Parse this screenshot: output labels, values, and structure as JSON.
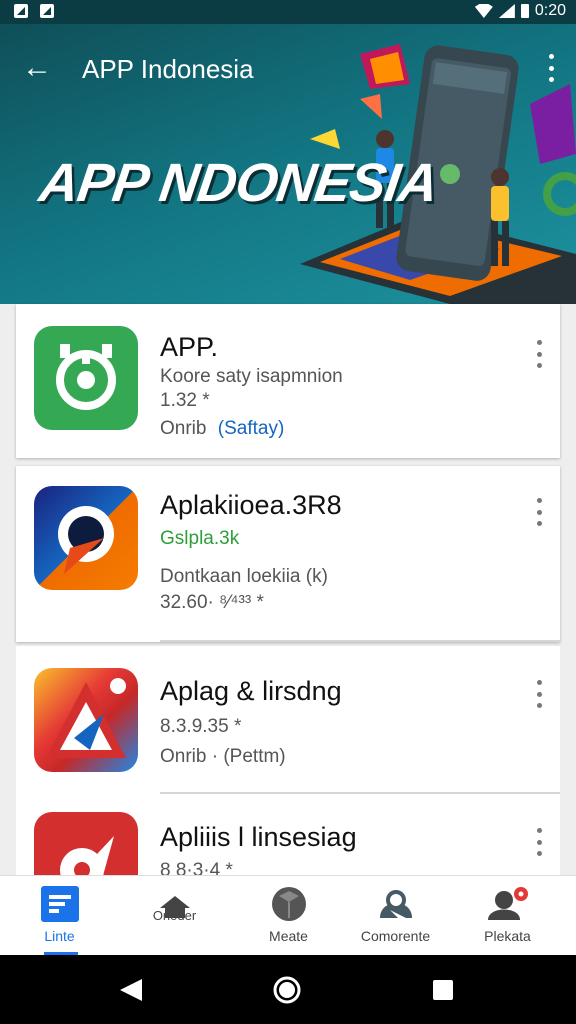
{
  "status_bar": {
    "time": "0:20"
  },
  "header": {
    "title": "APP Indonesia",
    "banner_text": "APP NDONESIA",
    "back_icon": "arrow-left-icon",
    "menu_icon": "more-vert-icon"
  },
  "apps": [
    {
      "name": "APP.",
      "line1": "Koore saty isapmnion",
      "line2": "1.32 *",
      "line3_a": "Onrib",
      "line3_b": "(Saftay)"
    },
    {
      "name": "Aplakiioea.3R8",
      "tag": "Gslpla.3k",
      "line1": "Dontkaan loekiia (k)",
      "line2": "32.60· ⁸⁄⁴³³ *"
    },
    {
      "name": "Aplag & lirsdng",
      "line1": "8.3.9.35 *",
      "line2": "Onrib · (Pettm)"
    },
    {
      "name": "Apliiis l linsesiag",
      "line1": "8 8·3·4 *"
    }
  ],
  "bottom_nav": [
    {
      "label": "Linte",
      "active": true
    },
    {
      "label": "Onoder",
      "active": false
    },
    {
      "label": "Meate",
      "active": false
    },
    {
      "label": "Comorente",
      "active": false
    },
    {
      "label": "Plekata",
      "active": false
    }
  ],
  "colors": {
    "header": "#127380",
    "accent": "#1a73e8",
    "green": "#2e9e3a",
    "link": "#1565c0"
  }
}
